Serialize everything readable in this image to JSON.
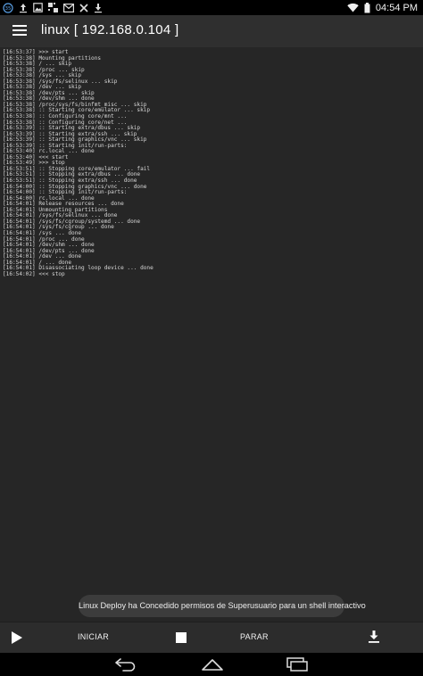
{
  "status_bar": {
    "time": "04:54 PM",
    "left_icons": [
      "notification-badge-icon",
      "upload-icon",
      "image-icon",
      "qr-icon",
      "gmail-icon",
      "cross-icon",
      "download-icon"
    ],
    "right_icons": [
      "wifi-icon",
      "battery-icon"
    ]
  },
  "app_bar": {
    "title": "linux  [ 192.168.0.104 ]"
  },
  "log": {
    "lines": [
      "[16:53:37] >>> start",
      "[16:53:38] Mounting partitions",
      "[16:53:38] / ... skip",
      "[16:53:38] /proc ... skip",
      "[16:53:38] /sys ... skip",
      "[16:53:38] /sys/fs/selinux ... skip",
      "[16:53:38] /dev ... skip",
      "[16:53:38] /dev/pts ... skip",
      "[16:53:38] /dev/shm ... done",
      "[16:53:38] /proc/sys/fs/binfmt_misc ... skip",
      "[16:53:38] :: Starting core/emulator ... skip",
      "[16:53:38] :: Configuring core/mnt ...",
      "[16:53:38] :: Configuring core/net ...",
      "[16:53:39] :: Starting extra/dbus ... skip",
      "[16:53:39] :: Starting extra/ssh ... skip",
      "[16:53:39] :: Starting graphics/vnc ... skip",
      "[16:53:39] :: Starting init/run-parts:",
      "[16:53:40] rc.local ... done",
      "[16:53:40] <<< start",
      "[16:53:49] >>> stop",
      "[16:53:51] :: Stopping core/emulator ... fail",
      "[16:53:51] :: Stopping extra/dbus ... done",
      "[16:53:51] :: Stopping extra/ssh ... done",
      "[16:54:00] :: Stopping graphics/vnc ... done",
      "[16:54:00] :: Stopping init/run-parts:",
      "[16:54:00] rc.local ... done",
      "[16:54:01] Release resources ... done",
      "[16:54:01] Unmounting partitions",
      "[16:54:01] /sys/fs/selinux ... done",
      "[16:54:01] /sys/fs/cgroup/systemd ... done",
      "[16:54:01] /sys/fs/cgroup ... done",
      "[16:54:01] /sys ... done",
      "[16:54:01] /proc ... done",
      "[16:54:01] /dev/shm ... done",
      "[16:54:01] /dev/pts ... done",
      "[16:54:01] /dev ... done",
      "[16:54:01] / ... done",
      "[16:54:01] Disassociating loop device ... done",
      "[16:54:02] <<< stop"
    ]
  },
  "toast": {
    "message": "Linux Deploy ha Concedido permisos de Superusuario para un shell interactivo"
  },
  "bottom_bar": {
    "start_label": "INICIAR",
    "stop_label": "PARAR",
    "play_icon": "play-icon",
    "stop_icon": "stop-square-icon",
    "download_icon": "download-icon"
  },
  "nav_bar": {
    "icons": [
      "back-icon",
      "home-icon",
      "recents-icon"
    ]
  },
  "colors": {
    "background": "#262626",
    "app_bar": "#2f2f2f",
    "text": "#d8d8d8",
    "toast_bg": "#3c3c3c"
  }
}
